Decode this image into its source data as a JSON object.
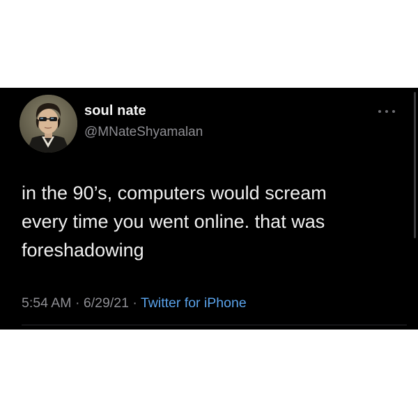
{
  "tweet": {
    "display_name": "soul nate",
    "handle": "@MNateShyamalan",
    "text_lines": [
      "in the 90’s, computers would scream",
      "every time you went online. that was",
      "foreshadowing"
    ],
    "time": "5:54 AM",
    "separator": "·",
    "date": "6/29/21",
    "source": "Twitter for iPhone",
    "icons": {
      "avatar": "profile-picture",
      "more": "more-options-icon"
    }
  },
  "colors": {
    "background": "#000000",
    "text": "#f0f0f0",
    "secondary": "#8e8e93",
    "link": "#5aa2ea"
  }
}
